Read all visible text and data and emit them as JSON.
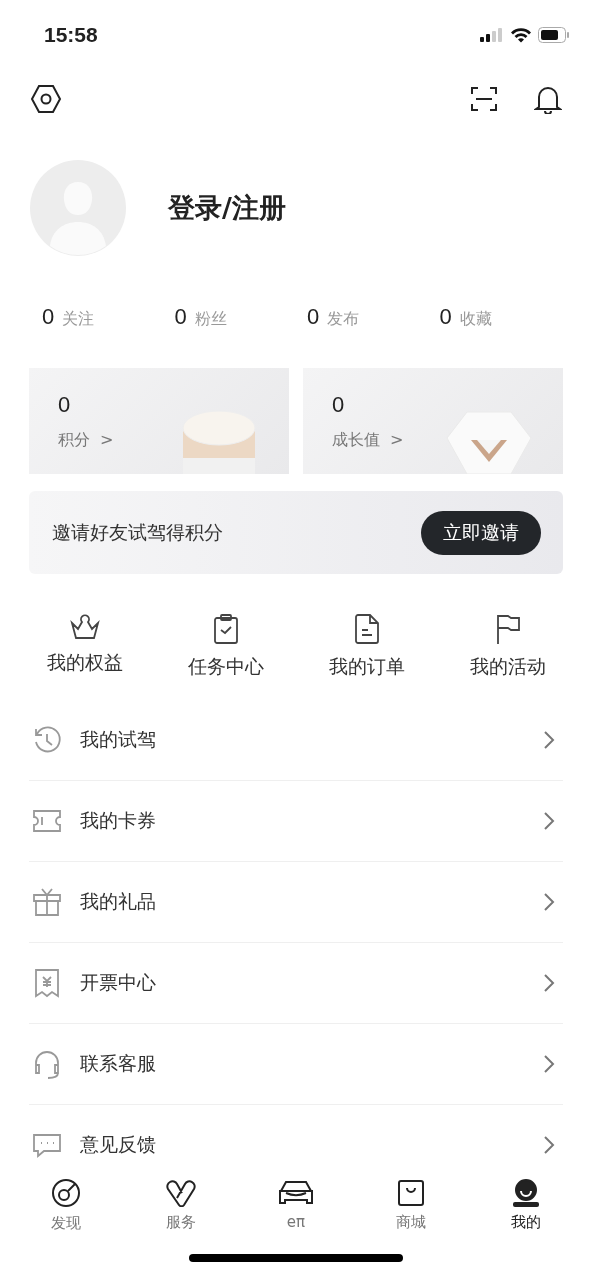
{
  "status_bar": {
    "time": "15:58"
  },
  "profile": {
    "login_label": "登录/注册"
  },
  "stats": [
    {
      "value": "0",
      "label": "关注"
    },
    {
      "value": "0",
      "label": "粉丝"
    },
    {
      "value": "0",
      "label": "发布"
    },
    {
      "value": "0",
      "label": "收藏"
    }
  ],
  "cards": [
    {
      "kind": "coin",
      "value": "0",
      "label": "积分",
      "arrow": ">"
    },
    {
      "kind": "diamond",
      "value": "0",
      "label": "成长值",
      "arrow": ">"
    }
  ],
  "invite_banner": {
    "text": "邀请好友试驾得积分",
    "button": "立即邀请"
  },
  "shortcuts": [
    {
      "kind": "crown",
      "label": "我的权益"
    },
    {
      "kind": "clipboard",
      "label": "任务中心"
    },
    {
      "kind": "document",
      "label": "我的订单"
    },
    {
      "kind": "flag",
      "label": "我的活动"
    }
  ],
  "menu": [
    {
      "kind": "history",
      "label": "我的试驾"
    },
    {
      "kind": "ticket",
      "label": "我的卡券"
    },
    {
      "kind": "gift",
      "label": "我的礼品"
    },
    {
      "kind": "invoice",
      "label": "开票中心"
    },
    {
      "kind": "headset",
      "label": "联系客服"
    },
    {
      "kind": "chat",
      "label": "意见反馈"
    }
  ],
  "tab_bar": [
    {
      "kind": "discover",
      "label": "发现",
      "selected": false
    },
    {
      "kind": "service",
      "label": "服务",
      "selected": false
    },
    {
      "kind": "car",
      "label": "eπ",
      "selected": false
    },
    {
      "kind": "shop",
      "label": "商城",
      "selected": false
    },
    {
      "kind": "me",
      "label": "我的",
      "selected": true
    }
  ]
}
